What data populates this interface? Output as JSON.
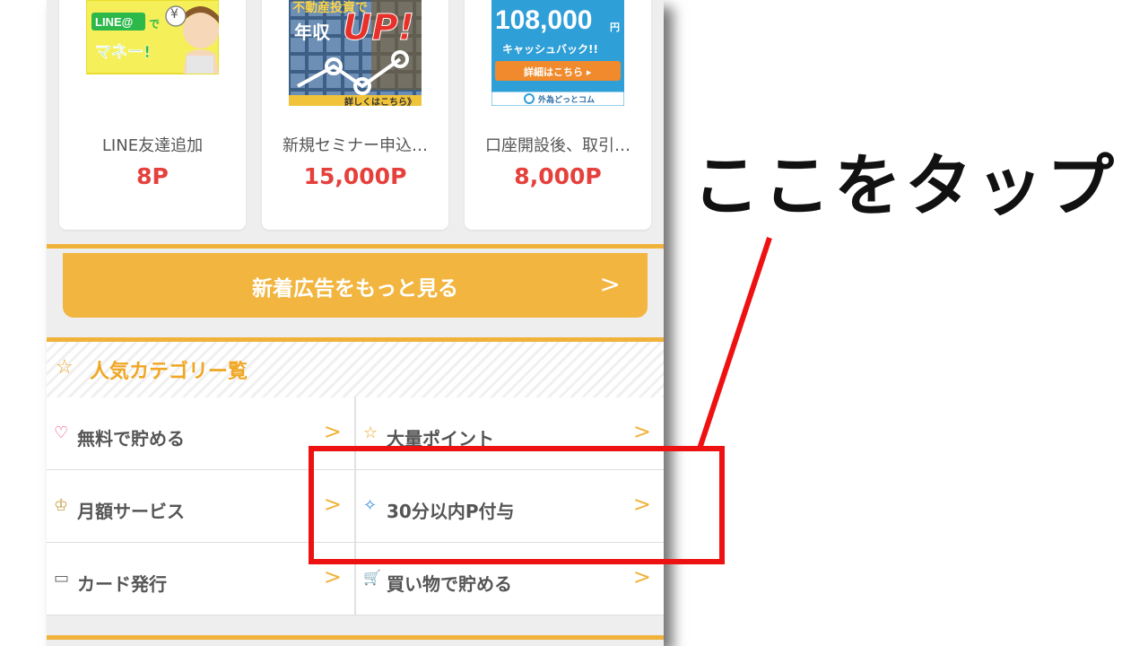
{
  "cards": [
    {
      "title": "LINE友達追加",
      "points": "8P",
      "banner": {
        "badge": "LINE@",
        "line1": "で",
        "line2": "マネー!",
        "yen": "¥"
      }
    },
    {
      "title": "新規セミナー申込…",
      "points": "15,000P",
      "banner": {
        "top": "不動産投資で",
        "line1": "年収",
        "line2": "UP!",
        "footer": "詳しくはこちら》"
      }
    },
    {
      "title": "口座開設後、取引…",
      "points": "8,000P",
      "banner": {
        "amount": "108,000",
        "unit": "円",
        "sub": "キャッシュバック!!",
        "button": "詳細はこちら ▸",
        "logo": "外為どっとコム"
      }
    }
  ],
  "more_button": {
    "label": "新着広告をもっと見る",
    "chevron": ">"
  },
  "categories": {
    "title": "人気カテゴリー覧",
    "title_icon": "star-outline-icon",
    "items": [
      {
        "label": "無料で貯める",
        "icon": "heart-outline-icon",
        "glyph": "♡",
        "color": "#e8457a"
      },
      {
        "label": "大量ポイント",
        "icon": "star-outline-icon",
        "glyph": "☆",
        "color": "#f0a623"
      },
      {
        "label": "月額サービス",
        "icon": "crown-outline-icon",
        "glyph": "♔",
        "color": "#c9a04a"
      },
      {
        "label": "30分以内P付与",
        "icon": "diamond-outline-icon",
        "glyph": "✧",
        "color": "#3f8fe0"
      },
      {
        "label": "カード発行",
        "icon": "credit-card-icon",
        "glyph": "▭",
        "color": "#666666"
      },
      {
        "label": "買い物で貯める",
        "icon": "shopping-cart-icon",
        "glyph": "🛒",
        "color": "#b04ec0"
      }
    ],
    "chevron": ">"
  },
  "annotation": {
    "text": "ここをタップ",
    "color": "#ee1111"
  },
  "colors": {
    "accent": "#f2b53f",
    "points_red": "#e5403c",
    "annotation_red": "#ee1111"
  }
}
